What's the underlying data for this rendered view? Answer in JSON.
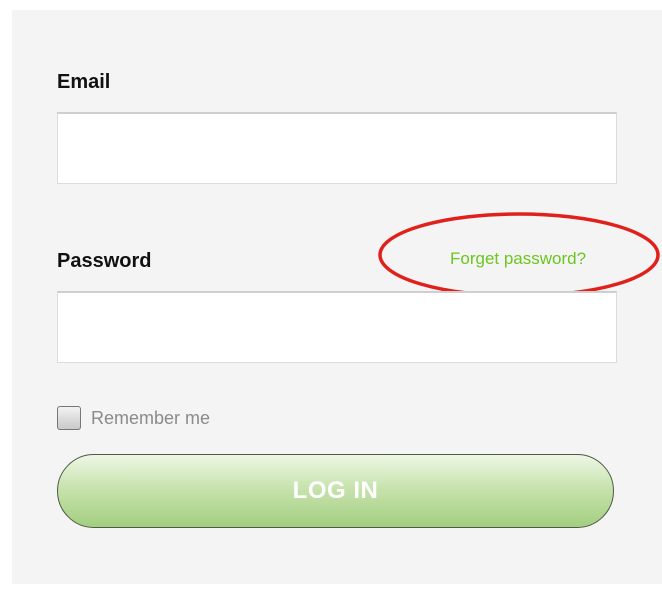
{
  "form": {
    "email": {
      "label": "Email",
      "value": "",
      "placeholder": ""
    },
    "password": {
      "label": "Password",
      "value": "",
      "placeholder": "",
      "forgot_link": "Forget password?"
    },
    "remember_me": {
      "label": "Remember me",
      "checked": false
    },
    "login_button": "LOG IN"
  },
  "colors": {
    "link_green": "#6cc61f",
    "button_green": "#a3ce80",
    "annotation_red": "#e0201b",
    "panel_background": "#f4f4f4"
  }
}
